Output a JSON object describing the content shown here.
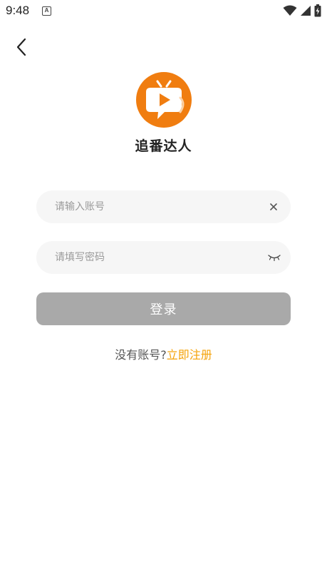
{
  "status_bar": {
    "time": "9:48",
    "notification_icon_letter": "A",
    "icons": [
      "wifi-icon",
      "cell-signal-icon",
      "battery-charging-icon"
    ]
  },
  "nav": {
    "back_icon": "chevron-left-icon"
  },
  "app": {
    "name": "追番达人",
    "logo_color": "#f07d10"
  },
  "form": {
    "account_placeholder": "请输入账号",
    "account_value": "",
    "password_placeholder": "请填写密码",
    "password_value": "",
    "clear_icon": "close-icon",
    "visibility_icon": "eye-closed-icon",
    "login_label": "登录",
    "login_bg": "#a9a9a9"
  },
  "register": {
    "prompt": "没有账号?",
    "link_label": "立即注册",
    "link_color": "#f5a30a"
  }
}
